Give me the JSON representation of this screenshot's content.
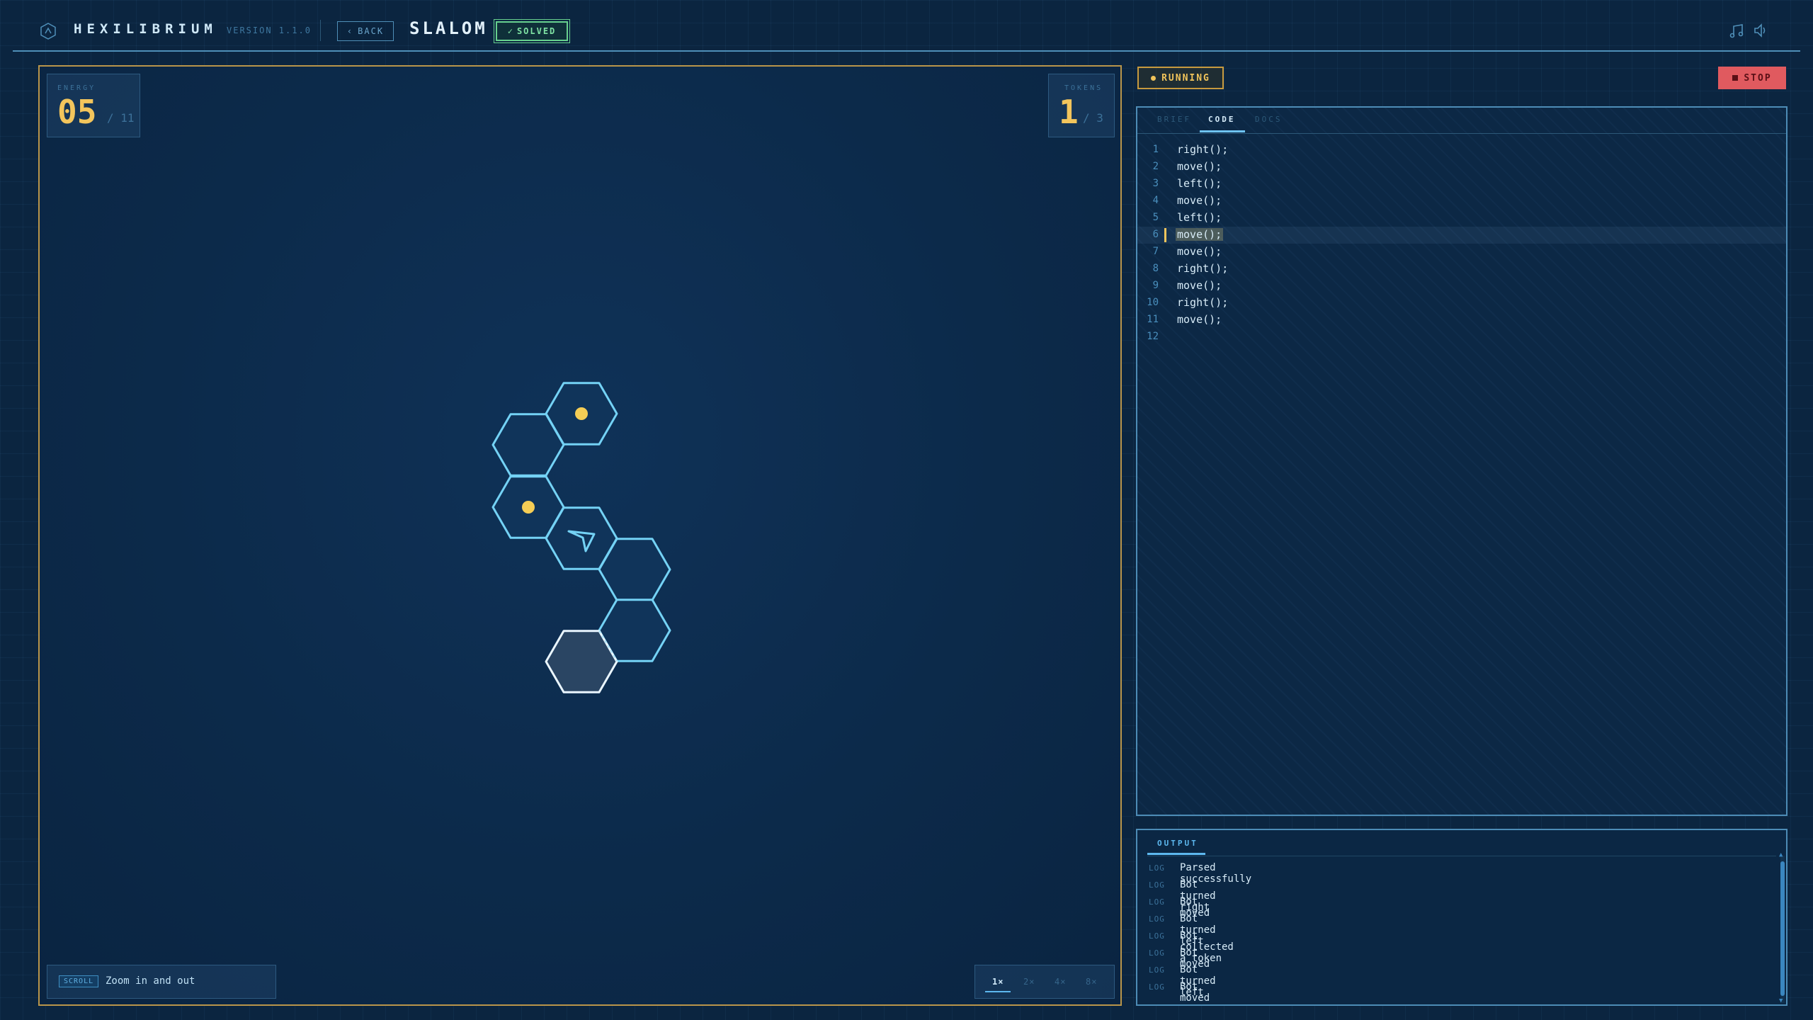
{
  "header": {
    "app_title": "HEXILIBRIUM",
    "version": "VERSION 1.1.0",
    "back_label": "BACK",
    "level_title": "SLALOM",
    "solved_label": "SOLVED",
    "logo_icon": "hexagon-logo-icon",
    "music_icon": "music-note-icon",
    "sound_icon": "speaker-icon"
  },
  "stats": {
    "energy_label": "ENERGY",
    "energy_value": "05",
    "energy_max": "/ 11",
    "tokens_label": "TOKENS",
    "tokens_value": "1",
    "tokens_max": "/ 3"
  },
  "hint": {
    "key": "SCROLL",
    "text": "Zoom in and out"
  },
  "speed": {
    "options": [
      "1×",
      "2×",
      "4×",
      "8×"
    ],
    "selected": "1×"
  },
  "run": {
    "status_label": "RUNNING",
    "stop_label": "STOP"
  },
  "editor": {
    "tabs": [
      "BRIEF",
      "CODE",
      "DOCS"
    ],
    "active_tab": "CODE",
    "current_line": 6,
    "lines": [
      {
        "n": "1",
        "code": "right();"
      },
      {
        "n": "2",
        "code": "move();"
      },
      {
        "n": "3",
        "code": "left();"
      },
      {
        "n": "4",
        "code": "move();"
      },
      {
        "n": "5",
        "code": "left();"
      },
      {
        "n": "6",
        "code": "move();"
      },
      {
        "n": "7",
        "code": "move();"
      },
      {
        "n": "8",
        "code": "right();"
      },
      {
        "n": "9",
        "code": "move();"
      },
      {
        "n": "10",
        "code": "right();"
      },
      {
        "n": "11",
        "code": "move();"
      },
      {
        "n": "12",
        "code": ""
      }
    ]
  },
  "output": {
    "tab_label": "OUTPUT",
    "logs": [
      {
        "tag": "LOG",
        "msg": "Parsed successfully"
      },
      {
        "tag": "LOG",
        "msg": "Bot turned right"
      },
      {
        "tag": "LOG",
        "msg": "Bot moved"
      },
      {
        "tag": "LOG",
        "msg": "Bot turned left"
      },
      {
        "tag": "LOG",
        "msg": "Bot collected a token"
      },
      {
        "tag": "LOG",
        "msg": "Bot moved"
      },
      {
        "tag": "LOG",
        "msg": "Bot turned left"
      },
      {
        "tag": "LOG",
        "msg": "Bot moved"
      }
    ]
  },
  "board": {
    "cell_color": "#10345a",
    "goal_color": "#2a4563",
    "edge_color": "#74d2f5",
    "goal_edge_color": "#eaf6ff",
    "token_color": "#f5cd55",
    "bot_icon": "arrow-cursor-icon"
  }
}
